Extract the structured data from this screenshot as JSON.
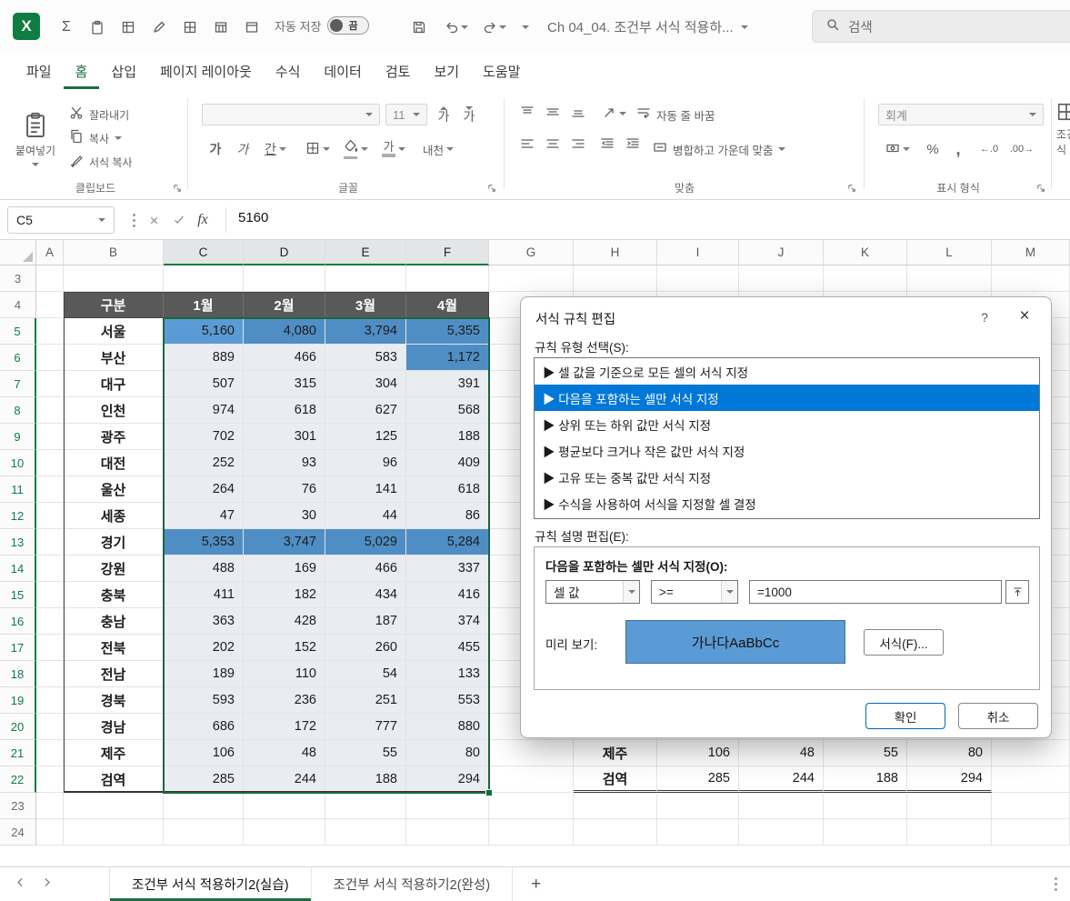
{
  "titlebar": {
    "logo": "X",
    "autosave_label": "자동 저장",
    "autosave_state": "끔",
    "doc_title": "Ch 04_04. 조건부 서식 적용하...",
    "search_label": "검색"
  },
  "menu": {
    "tabs": [
      {
        "label": "파일",
        "active": false
      },
      {
        "label": "홈",
        "active": true
      },
      {
        "label": "삽입",
        "active": false
      },
      {
        "label": "페이지 레이아웃",
        "active": false
      },
      {
        "label": "수식",
        "active": false
      },
      {
        "label": "데이터",
        "active": false
      },
      {
        "label": "검토",
        "active": false
      },
      {
        "label": "보기",
        "active": false
      },
      {
        "label": "도움말",
        "active": false
      }
    ]
  },
  "ribbon": {
    "clipboard": {
      "paste": "붙여넣기",
      "cut": "잘라내기",
      "copy": "복사",
      "format_painter": "서식 복사",
      "group_label": "클립보드"
    },
    "font": {
      "font_name": "",
      "font_size": "11",
      "grow": "가",
      "shrink": "가",
      "bold": "가",
      "italic": "가",
      "underline": "간",
      "font_color": "가",
      "phonetic": "내천",
      "group_label": "글꼴"
    },
    "alignment": {
      "wrap_text": "자동 줄 바꿈",
      "merge_center": "병합하고 가운데 맞춤",
      "group_label": "맞춤"
    },
    "number": {
      "format": "회계",
      "percent": "%",
      "comma": ",",
      "inc_decimal": "←.0",
      "dec_decimal": ".00→",
      "group_label": "표시 형식"
    },
    "styles_partial": "조건부 서식"
  },
  "formula_bar": {
    "cell_ref": "C5",
    "fx": "fx",
    "value": "5160"
  },
  "sheet": {
    "columns": [
      "A",
      "B",
      "C",
      "D",
      "E",
      "F",
      "G",
      "H",
      "I",
      "J",
      "K",
      "L",
      "M"
    ],
    "selected_columns": [
      "C",
      "D",
      "E",
      "F"
    ],
    "rows_start": 3,
    "rows_end": 24,
    "selected_rows_start": 5,
    "selected_rows_end": 22
  },
  "table": {
    "headers": [
      "구분",
      "1월",
      "2월",
      "3월",
      "4월"
    ],
    "active_cell": "C5",
    "rows": [
      {
        "label": "서울",
        "values": [
          "5,160",
          "4,080",
          "3,794",
          "5,355"
        ],
        "highlight": [
          true,
          true,
          true,
          true
        ]
      },
      {
        "label": "부산",
        "values": [
          "889",
          "466",
          "583",
          "1,172"
        ],
        "highlight": [
          false,
          false,
          false,
          true
        ]
      },
      {
        "label": "대구",
        "values": [
          "507",
          "315",
          "304",
          "391"
        ],
        "highlight": [
          false,
          false,
          false,
          false
        ]
      },
      {
        "label": "인천",
        "values": [
          "974",
          "618",
          "627",
          "568"
        ],
        "highlight": [
          false,
          false,
          false,
          false
        ]
      },
      {
        "label": "광주",
        "values": [
          "702",
          "301",
          "125",
          "188"
        ],
        "highlight": [
          false,
          false,
          false,
          false
        ]
      },
      {
        "label": "대전",
        "values": [
          "252",
          "93",
          "96",
          "409"
        ],
        "highlight": [
          false,
          false,
          false,
          false
        ]
      },
      {
        "label": "울산",
        "values": [
          "264",
          "76",
          "141",
          "618"
        ],
        "highlight": [
          false,
          false,
          false,
          false
        ]
      },
      {
        "label": "세종",
        "values": [
          "47",
          "30",
          "44",
          "86"
        ],
        "highlight": [
          false,
          false,
          false,
          false
        ]
      },
      {
        "label": "경기",
        "values": [
          "5,353",
          "3,747",
          "5,029",
          "5,284"
        ],
        "highlight": [
          true,
          true,
          true,
          true
        ]
      },
      {
        "label": "강원",
        "values": [
          "488",
          "169",
          "466",
          "337"
        ],
        "highlight": [
          false,
          false,
          false,
          false
        ]
      },
      {
        "label": "충북",
        "values": [
          "411",
          "182",
          "434",
          "416"
        ],
        "highlight": [
          false,
          false,
          false,
          false
        ]
      },
      {
        "label": "충남",
        "values": [
          "363",
          "428",
          "187",
          "374"
        ],
        "highlight": [
          false,
          false,
          false,
          false
        ]
      },
      {
        "label": "전북",
        "values": [
          "202",
          "152",
          "260",
          "455"
        ],
        "highlight": [
          false,
          false,
          false,
          false
        ]
      },
      {
        "label": "전남",
        "values": [
          "189",
          "110",
          "54",
          "133"
        ],
        "highlight": [
          false,
          false,
          false,
          false
        ]
      },
      {
        "label": "경북",
        "values": [
          "593",
          "236",
          "251",
          "553"
        ],
        "highlight": [
          false,
          false,
          false,
          false
        ]
      },
      {
        "label": "경남",
        "values": [
          "686",
          "172",
          "777",
          "880"
        ],
        "highlight": [
          false,
          false,
          false,
          false
        ]
      },
      {
        "label": "제주",
        "values": [
          "106",
          "48",
          "55",
          "80"
        ],
        "highlight": [
          false,
          false,
          false,
          false
        ]
      },
      {
        "label": "검역",
        "values": [
          "285",
          "244",
          "188",
          "294"
        ],
        "highlight": [
          false,
          false,
          false,
          false
        ]
      }
    ]
  },
  "right_table": {
    "rows": [
      {
        "label": "제주",
        "values": [
          "106",
          "48",
          "55",
          "80"
        ]
      },
      {
        "label": "검역",
        "values": [
          "285",
          "244",
          "188",
          "294"
        ]
      }
    ]
  },
  "dialog": {
    "title": "서식 규칙 편집",
    "help": "?",
    "close": "×",
    "rule_type_label": "규칙 유형 선택(S):",
    "rule_types": [
      "▶ 셀 값을 기준으로 모든 셀의 서식 지정",
      "▶ 다음을 포함하는 셀만 서식 지정",
      "▶ 상위 또는 하위 값만 서식 지정",
      "▶ 평균보다 크거나 작은 값만 서식 지정",
      "▶ 고유 또는 중복 값만 서식 지정",
      "▶ 수식을 사용하여 서식을 지정할 셀 결정"
    ],
    "selected_rule_index": 1,
    "rule_desc_label": "규칙 설명 편집(E):",
    "condition_label": "다음을 포함하는 셀만 서식 지정(O):",
    "operand_type": "셀 값",
    "operator": ">=",
    "value": "=1000",
    "preview_label": "미리 보기:",
    "preview_text": "가나다AaBbCc",
    "format_button": "서식(F)...",
    "ok_button": "확인",
    "cancel_button": "취소"
  },
  "tabbar": {
    "tabs": [
      {
        "label": "조건부 서식 적용하기2(실습)",
        "active": true
      },
      {
        "label": "조건부 서식 적용하기2(완성)",
        "active": false
      }
    ],
    "add": "+"
  },
  "colors": {
    "excel_green": "#107C41",
    "highlight_blue": "#5B9BD5",
    "highlight_blue_selected": "#4F8EC5",
    "selection_fill": "#E9EDF2",
    "header_dark": "#595959",
    "list_selected": "#0078D7"
  }
}
